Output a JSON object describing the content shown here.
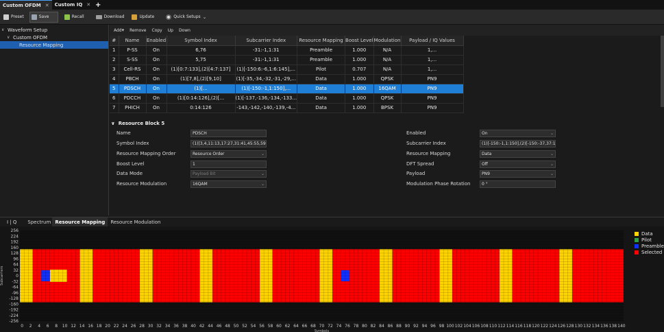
{
  "tabs": [
    {
      "label": "Custom OFDM",
      "active": true
    },
    {
      "label": "Custom IQ",
      "active": false
    }
  ],
  "toolbar": {
    "preset": "Preset",
    "save": "Save",
    "recall": "Recall",
    "download": "Download",
    "update": "Update",
    "quick_setups": "Quick Setups"
  },
  "tree": {
    "root": "Waveform Setup",
    "child": "Custom OFDM",
    "leaf": "Resource Mapping"
  },
  "rb_toolbar": {
    "add": "Add",
    "remove": "Remove",
    "copy": "Copy",
    "up": "Up",
    "down": "Down"
  },
  "table": {
    "columns": [
      "#",
      "Name",
      "Enabled",
      "Symbol Index",
      "Subcarrier Index",
      "Resource Mapping",
      "Boost Level",
      "Modulation",
      "Payload / IQ Values"
    ],
    "rows": [
      [
        "1",
        "P-SS",
        "On",
        "6,76",
        "-31:-1,1:31",
        "Preamble",
        "1.000",
        "N/A",
        "1,..."
      ],
      [
        "2",
        "S-SS",
        "On",
        "5,75",
        "-31:-1,1:31",
        "Preamble",
        "1.000",
        "N/A",
        "1,..."
      ],
      [
        "3",
        "Cell-RS",
        "On",
        "(1)[0:7:133],(2)[4:7:137]",
        "(1)[-150:6:-6,1:6:145],...",
        "Pilot",
        "0.707",
        "N/A",
        "1,..."
      ],
      [
        "4",
        "PBCH",
        "On",
        "(1)[7,8],(2)[9,10]",
        "(1)[-35,-34,-32,-31,-29,...",
        "Data",
        "1.000",
        "QPSK",
        "PN9"
      ],
      [
        "5",
        "PDSCH",
        "On",
        "(1)[...",
        "(1)[-150:-1,1:150],...",
        "Data",
        "1.000",
        "16QAM",
        "PN9"
      ],
      [
        "6",
        "PDCCH",
        "On",
        "(1)[0:14:126],(2)[...",
        "(1)[-137,-136,-134,-133...",
        "Data",
        "1.000",
        "QPSK",
        "PN9"
      ],
      [
        "7",
        "PHICH",
        "On",
        "0:14:126",
        "-143,-142,-140,-139,-4...",
        "Data",
        "1.000",
        "BPSK",
        "PN9"
      ]
    ],
    "selected_row": 4
  },
  "props": {
    "title": "Resource Block 5",
    "left": [
      {
        "label": "Name",
        "value": "PDSCH",
        "dropdown": false,
        "disabled": false
      },
      {
        "label": "Symbol Index",
        "value": "(1)[3,4,11:13,17:27,31:41,45:55,59:69,73...",
        "dropdown": false,
        "disabled": false
      },
      {
        "label": "Resource Mapping Order",
        "value": "Resource Order",
        "dropdown": true,
        "disabled": false
      },
      {
        "label": "Boost Level",
        "value": "1",
        "dropdown": false,
        "disabled": false
      },
      {
        "label": "Data Mode",
        "value": "Payload Bit",
        "dropdown": true,
        "disabled": true
      },
      {
        "label": "Resource Modulation",
        "value": "16QAM",
        "dropdown": true,
        "disabled": false
      }
    ],
    "right": [
      {
        "label": "Enabled",
        "value": "On",
        "dropdown": true
      },
      {
        "label": "Subcarrier Index",
        "value": "(1)[-150:-1,1:150],(2)[-150:-37,37:150]",
        "dropdown": false
      },
      {
        "label": "Resource Mapping",
        "value": "Data",
        "dropdown": true
      },
      {
        "label": "DFT Spread",
        "value": "Off",
        "dropdown": true
      },
      {
        "label": "Payload",
        "value": "PN9",
        "dropdown": true
      },
      {
        "label": "Modulation Phase Rotation",
        "value": "0 °",
        "dropdown": false
      }
    ]
  },
  "bottom_tabs": [
    {
      "label": "I | Q",
      "active": false
    },
    {
      "label": "Spectrum",
      "active": false
    },
    {
      "label": "Resource Mapping",
      "active": true
    },
    {
      "label": "Resource Modulation",
      "active": false
    }
  ],
  "chart_data": {
    "type": "heatmap",
    "xlabel": "Symbols",
    "ylabel": "Subcarriers",
    "x_ticks": [
      0,
      2,
      4,
      6,
      8,
      10,
      12,
      14,
      16,
      18,
      20,
      22,
      24,
      26,
      28,
      30,
      32,
      34,
      36,
      38,
      40,
      42,
      44,
      46,
      48,
      50,
      52,
      54,
      56,
      58,
      60,
      62,
      64,
      66,
      68,
      70,
      72,
      74,
      76,
      78,
      80,
      82,
      84,
      86,
      88,
      90,
      92,
      94,
      96,
      98,
      100,
      102,
      104,
      106,
      108,
      110,
      112,
      114,
      116,
      118,
      120,
      122,
      124,
      126,
      128,
      130,
      132,
      134,
      136,
      138,
      140
    ],
    "y_ticks": [
      256,
      224,
      192,
      160,
      128,
      96,
      64,
      32,
      0,
      -32,
      -64,
      -96,
      -128,
      -160,
      -192,
      -224,
      -256
    ],
    "xlim": [
      0,
      141
    ],
    "ylim": [
      -256,
      256
    ],
    "occupied_subcarriers": [
      -150,
      150
    ],
    "legend": [
      {
        "name": "Data",
        "color": "#ffd400"
      },
      {
        "name": "Pilot",
        "color": "#2ea043"
      },
      {
        "name": "Preamble",
        "color": "#1030ff"
      },
      {
        "name": "Selected",
        "color": "#ff0000"
      }
    ],
    "data_symbol_ranges": [
      [
        0,
        2
      ],
      [
        14,
        16
      ],
      [
        28,
        30
      ],
      [
        42,
        44
      ],
      [
        56,
        58
      ],
      [
        70,
        72
      ],
      [
        84,
        86
      ],
      [
        98,
        100
      ],
      [
        112,
        114
      ],
      [
        126,
        128
      ]
    ],
    "preamble_symbols": [
      5,
      6,
      75,
      76
    ],
    "pbch_block": {
      "symbols": [
        7,
        10
      ],
      "subcarriers": [
        -35,
        35
      ]
    },
    "selected_symbol_ranges": [
      [
        3,
        13
      ],
      [
        17,
        27
      ],
      [
        31,
        41
      ],
      [
        45,
        55
      ],
      [
        59,
        69
      ],
      [
        73,
        83
      ],
      [
        87,
        97
      ],
      [
        101,
        111
      ],
      [
        115,
        125
      ],
      [
        129,
        140
      ]
    ]
  }
}
